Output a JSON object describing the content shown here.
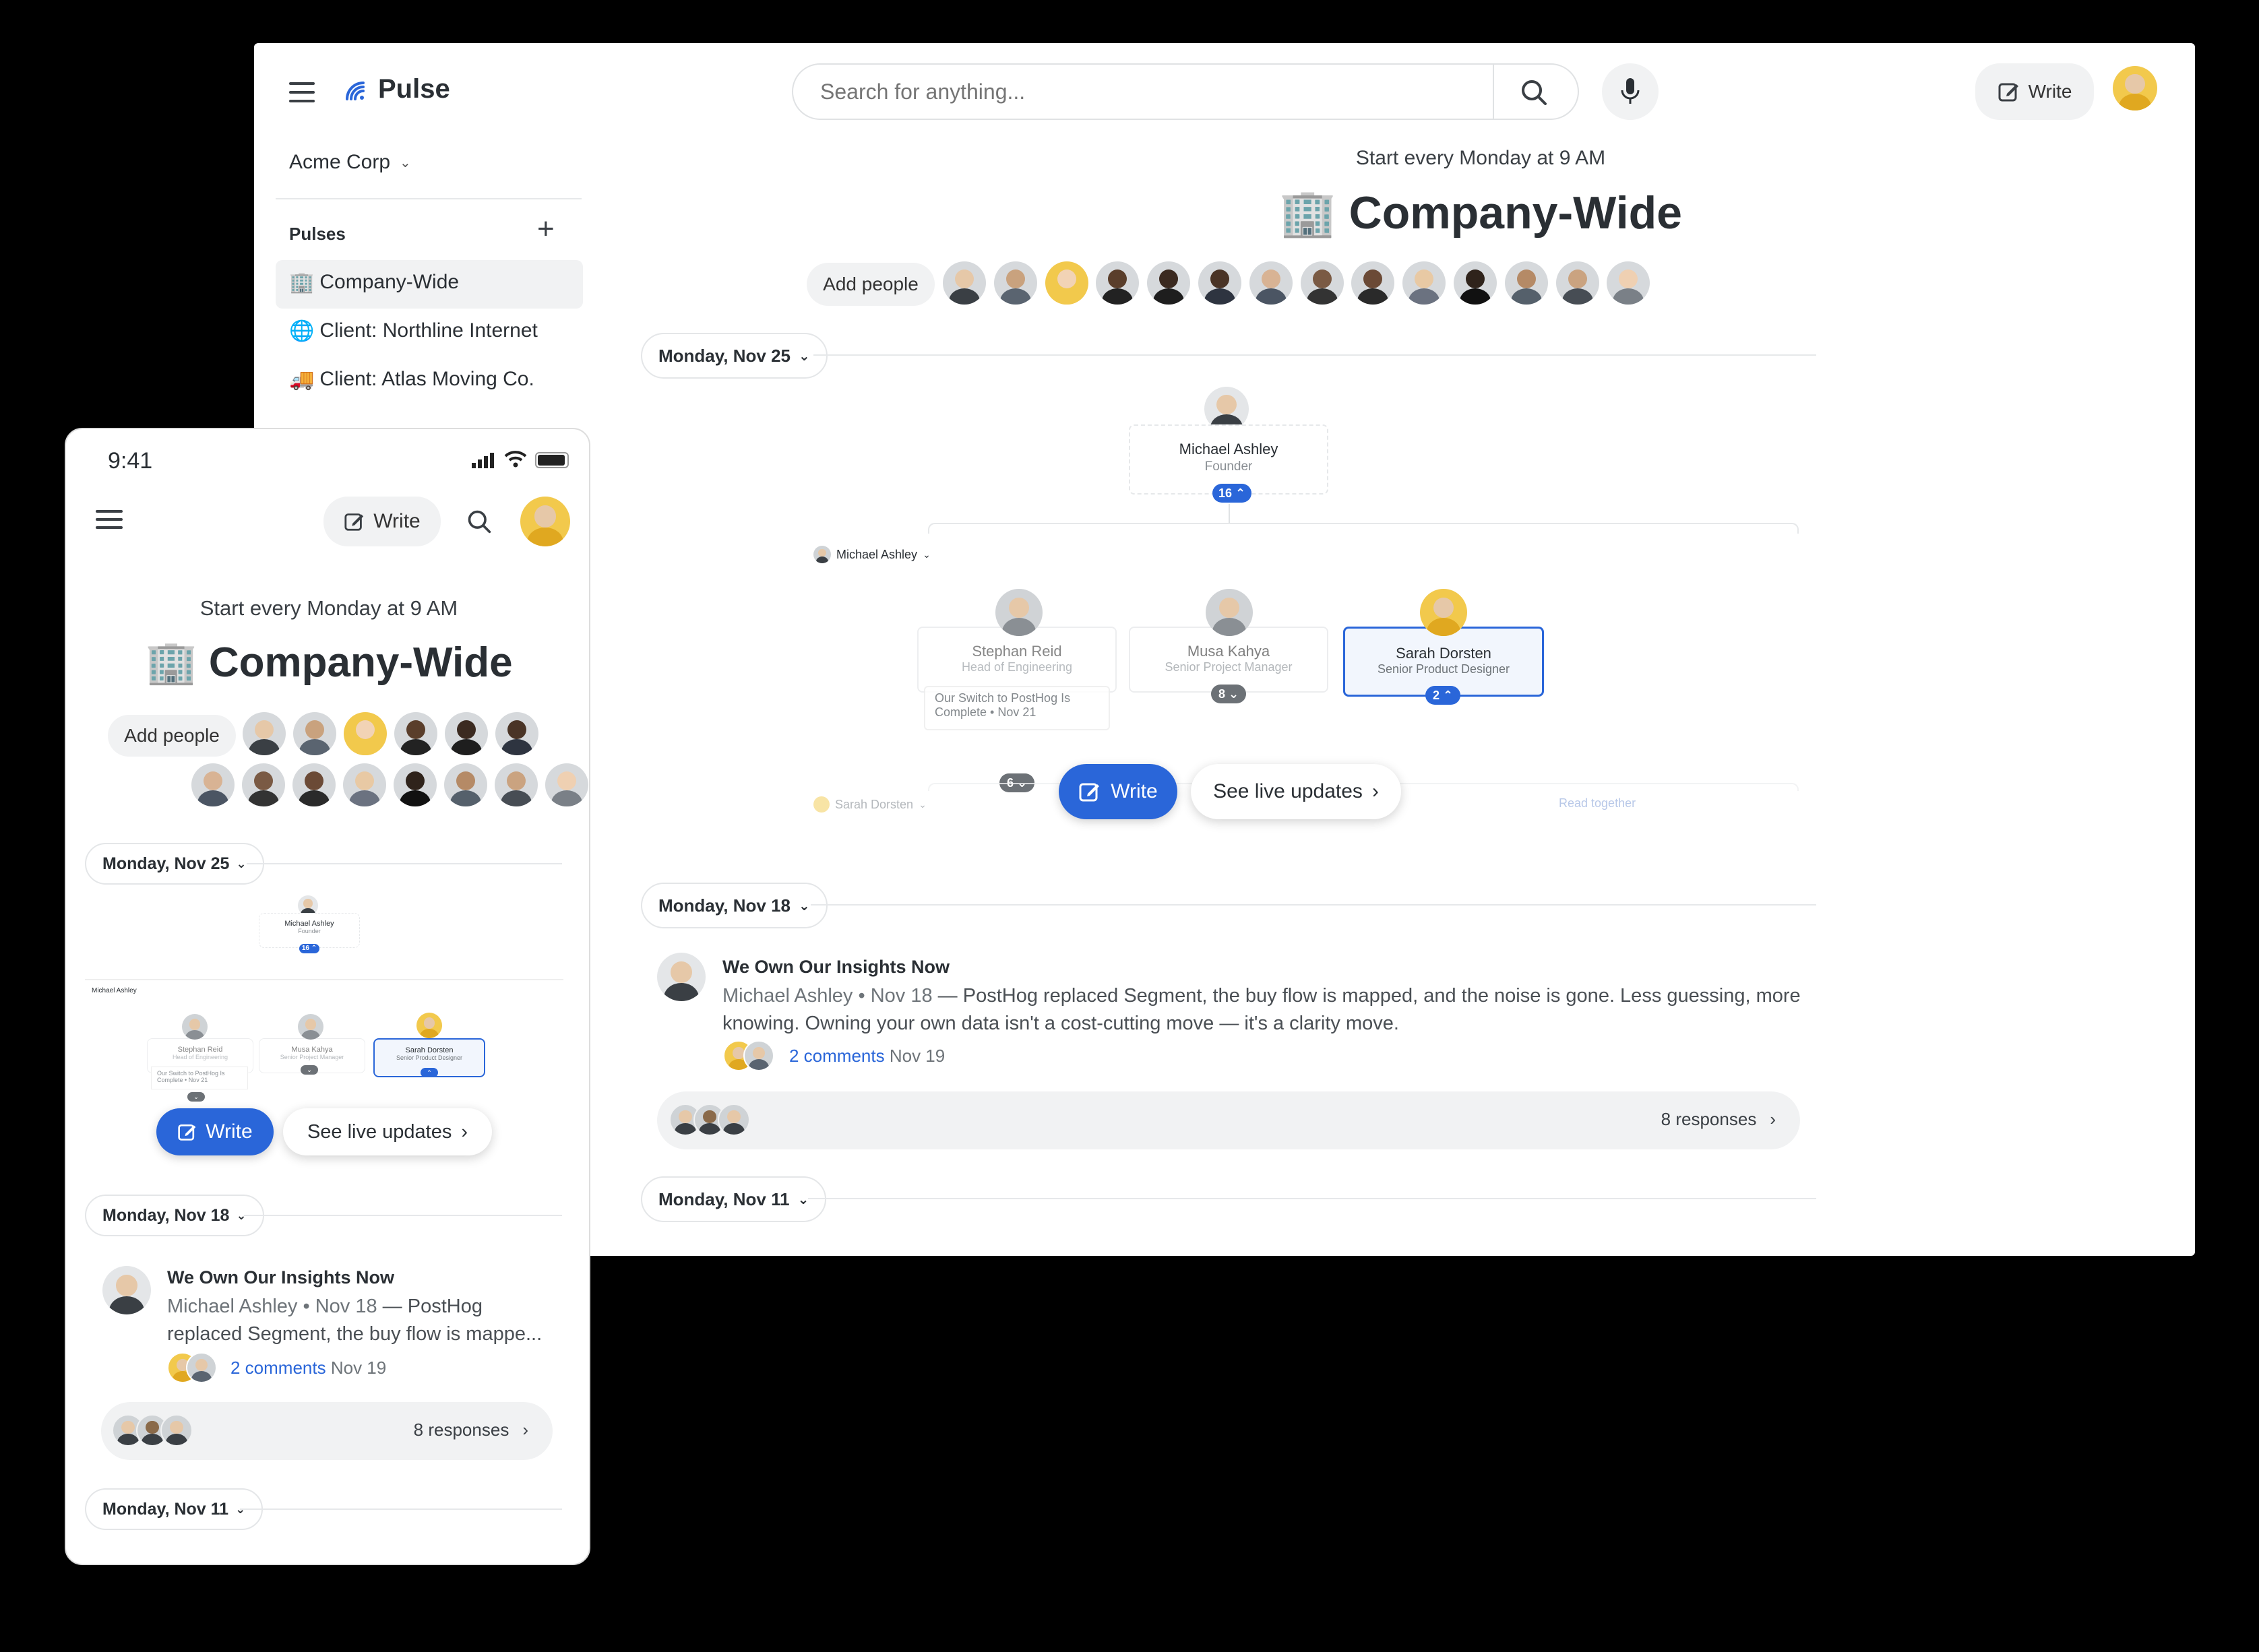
{
  "desktop": {
    "app_name": "Pulse",
    "search_placeholder": "Search for anything...",
    "write_label": "Write",
    "workspace": "Acme Corp",
    "pulses_heading": "Pulses",
    "pulses": [
      {
        "emoji": "🏢",
        "label": "Company-Wide"
      },
      {
        "emoji": "🌐",
        "label": "Client: Northline Internet"
      },
      {
        "emoji": "🚚",
        "label": "Client: Atlas Moving Co."
      }
    ],
    "schedule": "Start every Monday at 9 AM",
    "title_emoji": "🏢",
    "title": "Company-Wide",
    "add_people": "Add people",
    "dates": [
      "Monday, Nov 25",
      "Monday, Nov 18",
      "Monday, Nov 11"
    ],
    "org": {
      "root_name": "Michael Ashley",
      "root_role": "Founder",
      "root_count": "16",
      "branch_label": "Michael Ashley",
      "reports": [
        {
          "name": "Stephan Reid",
          "role": "Head of Engineering",
          "post": "Our Switch to PostHog Is Complete",
          "post_date": "Nov 21",
          "count": "6"
        },
        {
          "name": "Musa Kahya",
          "role": "Senior Project Manager",
          "count": "8"
        },
        {
          "name": "Sarah Dorsten",
          "role": "Senior Product Designer",
          "count": "2"
        }
      ],
      "bottom_branch": "Sarah Dorsten",
      "read_together": "Read together"
    },
    "write_btn": "Write",
    "live_btn": "See live updates",
    "post": {
      "title": "We Own Our Insights Now",
      "author": "Michael Ashley",
      "date": "Nov 18",
      "body": "PostHog replaced Segment, the buy flow is mapped, and the noise is gone. Less guessing, more knowing. Owning your own data isn't a cost-cutting move — it's a clarity move.",
      "comments": "2 comments",
      "comments_date": "Nov 19",
      "responses": "8 responses"
    }
  },
  "phone": {
    "time": "9:41",
    "write_label": "Write",
    "schedule": "Start every Monday at 9 AM",
    "title_emoji": "🏢",
    "title": "Company-Wide",
    "add_people": "Add people",
    "dates": [
      "Monday, Nov 25",
      "Monday, Nov 18",
      "Monday, Nov 11"
    ],
    "org": {
      "root_name": "Michael Ashley",
      "root_role": "Founder",
      "root_count": "16",
      "branch_label": "Michael Ashley",
      "reports": [
        {
          "name": "Stephan Reid",
          "role": "Head of Engineering",
          "post": "Our Switch to PostHog Is Complete",
          "post_date": "Nov 21"
        },
        {
          "name": "Musa Kahya",
          "role": "Senior Project Manager"
        },
        {
          "name": "Sarah Dorsten",
          "role": "Senior Product Designer"
        }
      ]
    },
    "write_btn": "Write",
    "live_btn": "See live updates",
    "post": {
      "title": "We Own Our Insights Now",
      "author": "Michael Ashley",
      "date": "Nov 18",
      "body_line1": "PostHog",
      "body_line2": "replaced Segment, the buy flow is mappe...",
      "comments": "2 comments",
      "comments_date": "Nov 19",
      "responses": "8 responses"
    }
  },
  "colors": {
    "accent": "#2a66d9",
    "background": "#000000",
    "surface": "#ffffff",
    "chip": "#f1f2f3"
  }
}
